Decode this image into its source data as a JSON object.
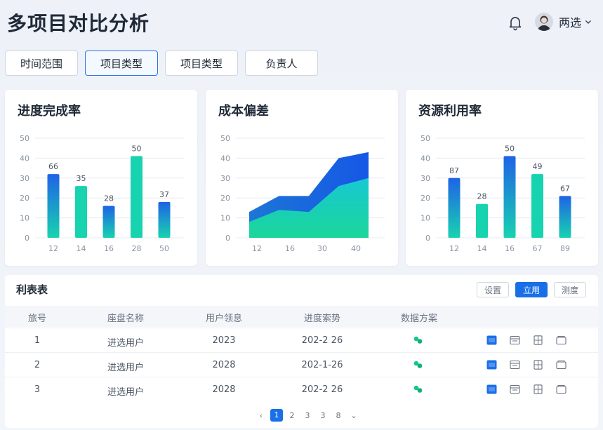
{
  "header": {
    "title": "多项目对比分析",
    "user_name": "两选"
  },
  "filters": [
    "时间范围",
    "项目类型",
    "项目类型",
    "负责人"
  ],
  "colors": {
    "accent": "#1a6fe8",
    "teal": "#17d3b0",
    "blue": "#1f63e6"
  },
  "charts": {
    "progress": {
      "title": "进度完成率"
    },
    "cost": {
      "title": "成本偏差"
    },
    "resource": {
      "title": "资源利用率"
    }
  },
  "chart_data": [
    {
      "type": "bar",
      "title": "进度完成率",
      "ylim": [
        0,
        50
      ],
      "yticks": [
        0,
        10,
        20,
        30,
        40,
        50
      ],
      "categories": [
        "12",
        "14",
        "16",
        "28",
        "50"
      ],
      "values": [
        32,
        26,
        16,
        41,
        18
      ],
      "data_labels": [
        "66",
        "35",
        "28",
        "50",
        "37"
      ],
      "grid": true
    },
    {
      "type": "area",
      "title": "成本偏差",
      "ylim": [
        0,
        50
      ],
      "yticks": [
        0,
        10,
        20,
        30,
        40,
        50
      ],
      "xticks": [
        "12",
        "16",
        "30",
        "40"
      ],
      "x": [
        0,
        1,
        2,
        3,
        4
      ],
      "series": [
        {
          "values": [
            13,
            21,
            21,
            40,
            43
          ]
        },
        {
          "values": [
            8,
            14,
            13,
            26,
            30
          ]
        }
      ],
      "grid": true
    },
    {
      "type": "bar",
      "title": "资源利用率",
      "ylim": [
        0,
        50
      ],
      "yticks": [
        0,
        10,
        20,
        30,
        40,
        50
      ],
      "categories": [
        "12",
        "14",
        "16",
        "67",
        "89"
      ],
      "values": [
        30,
        17,
        41,
        32,
        21
      ],
      "data_labels": [
        "87",
        "28",
        "50",
        "49",
        "67"
      ],
      "grid": true
    }
  ],
  "table": {
    "title": "利表表",
    "buttons": [
      "设置",
      "立用",
      "测度"
    ],
    "columns": [
      "旅号",
      "座盘名称",
      "用户领息",
      "进度索势",
      "数据方案"
    ],
    "rows": [
      {
        "no": "1",
        "name": "进选用户",
        "year": "2023",
        "date": "202-2 26"
      },
      {
        "no": "2",
        "name": "进选用户",
        "year": "2028",
        "date": "202-1-26"
      },
      {
        "no": "3",
        "name": "进选用户",
        "year": "2028",
        "date": "202-2 26"
      }
    ],
    "pagination": {
      "prev": "‹",
      "pages": [
        "1",
        "2",
        "3",
        "3",
        "8"
      ],
      "next": "⌄"
    }
  }
}
